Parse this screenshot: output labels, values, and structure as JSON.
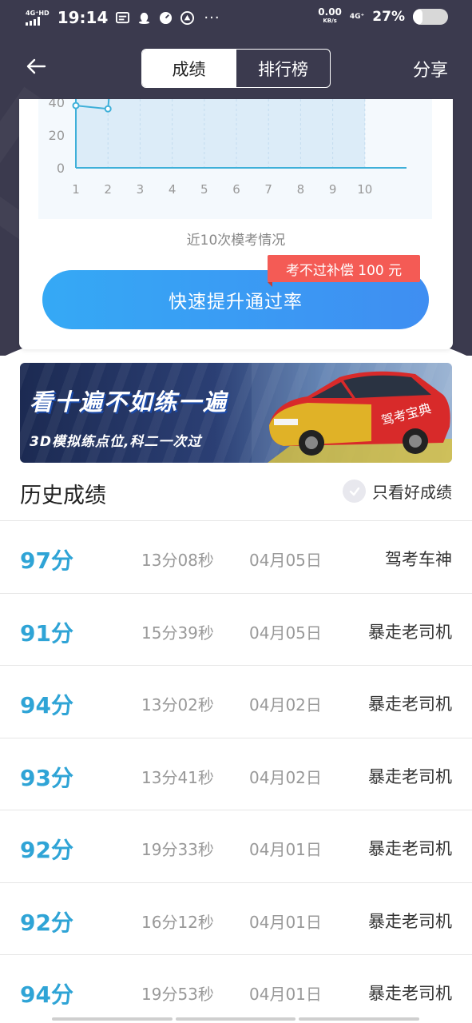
{
  "status_bar": {
    "network_left": "4G⁺HD",
    "time": "19:14",
    "more": "···",
    "speed_value": "0.00",
    "speed_unit": "KB/s",
    "network_right": "4G⁺",
    "battery": "27%"
  },
  "nav": {
    "tabs": [
      {
        "label": "成绩",
        "active": true
      },
      {
        "label": "排行榜",
        "active": false
      }
    ],
    "share_label": "分享"
  },
  "chart_data": {
    "type": "line",
    "title": "",
    "caption": "近10次模考情况",
    "x": [
      1,
      2,
      3,
      4,
      5,
      6,
      7,
      8,
      9,
      10
    ],
    "y_ticks_visible": [
      0,
      20,
      40
    ],
    "visible_points": [
      {
        "x": 1,
        "y": 38
      },
      {
        "x": 2,
        "y": 36
      }
    ],
    "grid": true,
    "xlabel": "",
    "ylabel": ""
  },
  "cta": {
    "label": "快速提升通过率",
    "badge": "考不过补偿 100 元"
  },
  "banner": {
    "headline": "看十遍不如练一遍",
    "subline": "3D模拟练点位,科二一次过",
    "car_text": "驾考宝典"
  },
  "history": {
    "title": "历史成绩",
    "filter_label": "只看好成绩",
    "colors": {
      "score": "#2fa4d6"
    },
    "rows": [
      {
        "score": "97分",
        "duration": "13分08秒",
        "date": "04月05日",
        "title": "驾考车神"
      },
      {
        "score": "91分",
        "duration": "15分39秒",
        "date": "04月05日",
        "title": "暴走老司机"
      },
      {
        "score": "94分",
        "duration": "13分02秒",
        "date": "04月02日",
        "title": "暴走老司机"
      },
      {
        "score": "93分",
        "duration": "13分41秒",
        "date": "04月02日",
        "title": "暴走老司机"
      },
      {
        "score": "92分",
        "duration": "19分33秒",
        "date": "04月01日",
        "title": "暴走老司机"
      },
      {
        "score": "92分",
        "duration": "16分12秒",
        "date": "04月01日",
        "title": "暴走老司机"
      },
      {
        "score": "94分",
        "duration": "19分53秒",
        "date": "04月01日",
        "title": "暴走老司机"
      }
    ]
  }
}
